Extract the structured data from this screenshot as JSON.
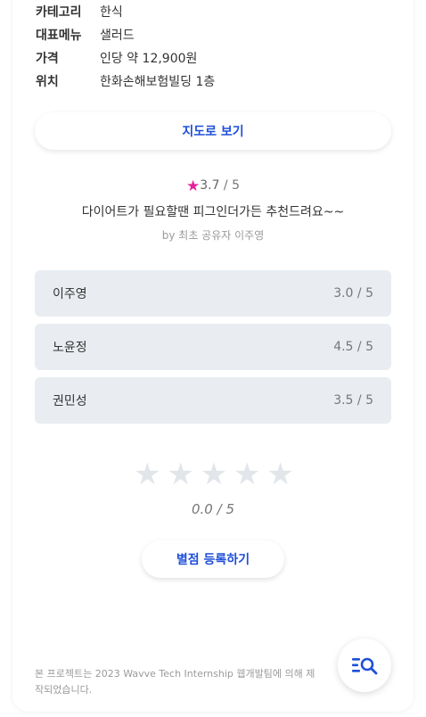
{
  "info": [
    {
      "label": "카테고리",
      "value": "한식"
    },
    {
      "label": "대표메뉴",
      "value": "샐러드"
    },
    {
      "label": "가격",
      "value": "인당 약 12,900원"
    },
    {
      "label": "위치",
      "value": "한화손해보험빌딩 1층"
    }
  ],
  "map_button_label": "지도로 보기",
  "rating": {
    "star": "★",
    "value": "3.7",
    "max": " / 5"
  },
  "comment": "다이어트가 필요할땐 피그인더가든 추천드려요~~",
  "by_line": "by 최초 공유자 이주영",
  "reviews": [
    {
      "name": "이주영",
      "score": "3.0 / 5"
    },
    {
      "name": "노윤정",
      "score": "4.5 / 5"
    },
    {
      "name": "권민성",
      "score": "3.5 / 5"
    }
  ],
  "star_input": {
    "stars": [
      "★",
      "★",
      "★",
      "★",
      "★"
    ],
    "score": "0.0 / 5"
  },
  "submit_button_label": "별점 등록하기",
  "footer_text": "본 프로젝트는 2023 Wavve Tech Internship 웹개발팀에 의해 제작되었습니다.",
  "colors": {
    "accent": "#1f4fd8",
    "star": "#e6209a",
    "row_bg": "#e9edf1"
  },
  "icons": {
    "fab": "list-search-icon"
  }
}
